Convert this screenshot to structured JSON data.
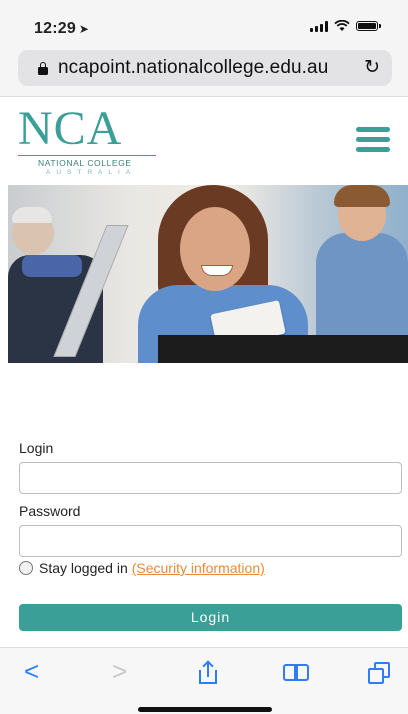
{
  "status_bar": {
    "time": "12:29"
  },
  "browser": {
    "url": "ncapoint.nationalcollege.edu.au"
  },
  "site": {
    "logo_main": "NCA",
    "logo_line1": "NATIONAL COLLEGE",
    "logo_line2": "AUSTRALIA"
  },
  "form": {
    "login_label": "Login",
    "login_value": "",
    "password_label": "Password",
    "password_value": "",
    "stay_logged_in_label": "Stay logged in",
    "security_link": "(Security information)",
    "login_button": "Login"
  },
  "colors": {
    "brand": "#3a9f97",
    "link": "#e88b39",
    "ios_blue": "#2f7cf6"
  },
  "icons": [
    "location-arrow-icon",
    "signal-icon",
    "wifi-icon",
    "battery-icon",
    "lock-icon",
    "reload-icon",
    "hamburger-menu-icon",
    "back-icon",
    "forward-icon",
    "share-icon",
    "bookmarks-icon",
    "tabs-icon"
  ]
}
